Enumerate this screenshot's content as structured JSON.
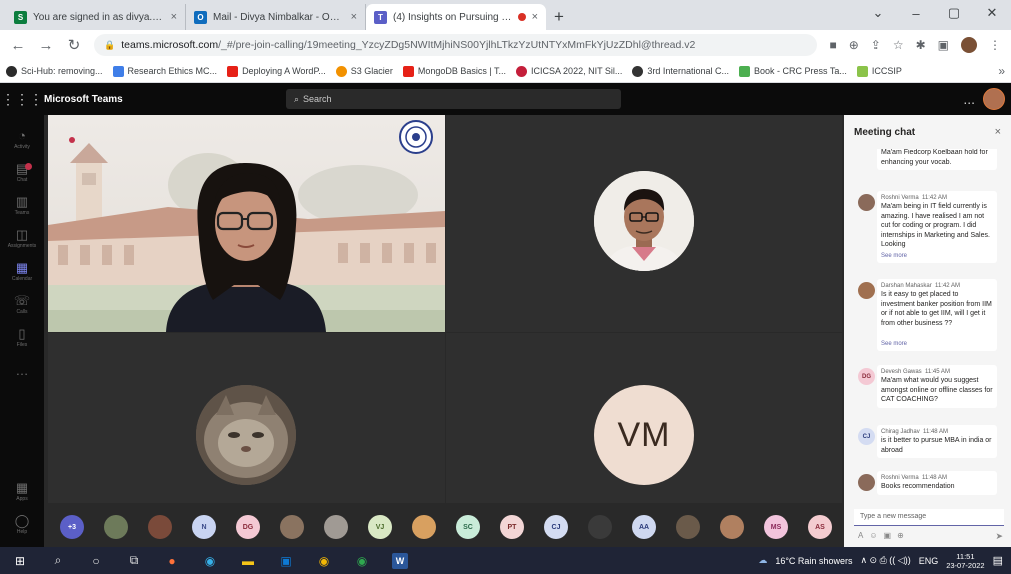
{
  "browser": {
    "tabs": [
      {
        "title": "You are signed in as divya.nimbk",
        "favicon_color": "#0c7d3e",
        "favicon_glyph": "S"
      },
      {
        "title": "Mail - Divya Nimbalkar - Outlook",
        "favicon_color": "#0f6cbd",
        "favicon_glyph": "O"
      },
      {
        "title": "(4) Insights on Pursuing MB",
        "favicon_color": "#5b5fc7",
        "favicon_glyph": "T"
      }
    ],
    "new_tab": "+",
    "url_host": "teams.microsoft.com",
    "url_path": "/_#/pre-join-calling/19meeting_YzcyZDg5NWItMjhiNS00YjlhLTkzYzUtNTYxMmFkYjUzZDhl@thread.v2",
    "bookmarks": [
      {
        "label": "Sci-Hub: removing...",
        "color": "#2b2b2b"
      },
      {
        "label": "Research Ethics MC...",
        "color": "#3f7ee8"
      },
      {
        "label": "Deploying A WordP...",
        "color": "#e62117"
      },
      {
        "label": "S3 Glacier",
        "color": "#f29100"
      },
      {
        "label": "MongoDB Basics | T...",
        "color": "#e62117"
      },
      {
        "label": "ICICSA 2022, NIT Sil...",
        "color": "#c41e3a"
      },
      {
        "label": "3rd International C...",
        "color": "#333333"
      },
      {
        "label": "Book - CRC Press Ta...",
        "color": "#4caf50"
      },
      {
        "label": "ICCSIP",
        "color": "#8bc34a"
      }
    ],
    "bookmarks_more": "»"
  },
  "teams": {
    "app_name": "Microsoft Teams",
    "search_placeholder": "Search",
    "more": "...",
    "rail": [
      {
        "label": "Activity",
        "icon": "bell-icon",
        "glyph": "🔔",
        "active": false,
        "badge": false
      },
      {
        "label": "Chat",
        "icon": "chat-icon",
        "glyph": "💬",
        "active": false,
        "badge": true
      },
      {
        "label": "Teams",
        "icon": "teams-icon",
        "glyph": "👥",
        "active": false,
        "badge": false
      },
      {
        "label": "Assignments",
        "icon": "assignments-icon",
        "glyph": "📋",
        "active": false,
        "badge": false
      },
      {
        "label": "Calendar",
        "icon": "calendar-icon",
        "glyph": "▦",
        "active": true,
        "badge": false
      },
      {
        "label": "Calls",
        "icon": "phone-icon",
        "glyph": "📞",
        "active": false,
        "badge": false
      },
      {
        "label": "Files",
        "icon": "files-icon",
        "glyph": "📄",
        "active": false,
        "badge": false
      },
      {
        "label": "",
        "icon": "more-icon",
        "glyph": "…",
        "active": false,
        "badge": false
      }
    ],
    "rail_bottom": [
      {
        "label": "Apps",
        "icon": "apps-icon",
        "glyph": "▦"
      },
      {
        "label": "Help",
        "icon": "help-icon",
        "glyph": "?"
      }
    ],
    "vm_initials": "VM",
    "attendees": [
      {
        "initials": "+3",
        "color": "#5b5fc7",
        "photo": false
      },
      {
        "initials": "",
        "color": "#6d7a5a",
        "photo": true
      },
      {
        "initials": "",
        "color": "#7a4a3a",
        "photo": true
      },
      {
        "initials": "N",
        "color": "#c9d4f2",
        "photo": false,
        "text_color": "#3b4a8a"
      },
      {
        "initials": "DG",
        "color": "#f4c9d4",
        "photo": false,
        "text_color": "#8a2a3a"
      },
      {
        "initials": "",
        "color": "#8a7360",
        "photo": true
      },
      {
        "initials": "",
        "color": "#a09a94",
        "photo": true
      },
      {
        "initials": "VJ",
        "color": "#d9e8c4",
        "photo": false,
        "text_color": "#4a6a2a"
      },
      {
        "initials": "",
        "color": "#d8a060",
        "photo": true
      },
      {
        "initials": "SC",
        "color": "#c9ecd9",
        "photo": false,
        "text_color": "#2a6a4a"
      },
      {
        "initials": "PT",
        "color": "#f3d6d6",
        "photo": false,
        "text_color": "#7a2a2a"
      },
      {
        "initials": "CJ",
        "color": "#d4dcf2",
        "photo": false,
        "text_color": "#2a3a7a"
      },
      {
        "initials": "",
        "color": "#3a3a3a",
        "photo": true
      },
      {
        "initials": "AA",
        "color": "#cfd8f0",
        "photo": false,
        "text_color": "#2a3a7a"
      },
      {
        "initials": "",
        "color": "#6a5a4a",
        "photo": true
      },
      {
        "initials": "",
        "color": "#b08060",
        "photo": true
      },
      {
        "initials": "MS",
        "color": "#f2c4dc",
        "photo": false,
        "text_color": "#8a2a5a"
      },
      {
        "initials": "AS",
        "color": "#f4ccd0",
        "photo": false,
        "text_color": "#8a2a3a"
      }
    ]
  },
  "chat": {
    "title": "Meeting chat",
    "close": "×",
    "messages": [
      {
        "name": "",
        "time": "",
        "text": "Ma'am Fiedcorp Koelbaan hold for enhancing your vocab.",
        "see_more": "",
        "initials": "",
        "avatar_color": "#ffffff",
        "avatar_text": "#000000",
        "photo": false
      },
      {
        "name": "Roshni Verma",
        "time": "11:42 AM",
        "text": "Ma'am being in IT field currently is amazing. I have realised I am not cut for coding or program. I did internships in Marketing and Sales. Looking",
        "see_more": "See more",
        "initials": "",
        "avatar_color": "#8a6a5a",
        "avatar_text": "#ffffff",
        "photo": true
      },
      {
        "name": "Darshan Mahaskar",
        "time": "11:42 AM",
        "text": "Is it easy to get placed to investment banker position from IIM or if not able to get IIM, will I get it from other business ??",
        "see_more": "See more",
        "initials": "",
        "avatar_color": "#a07050",
        "avatar_text": "#ffffff",
        "photo": true
      },
      {
        "name": "Devesh Gawas",
        "time": "11:45 AM",
        "text": "Ma'am what would you suggest amongst online or offline classes for CAT COACHING?",
        "see_more": "",
        "initials": "DG",
        "avatar_color": "#f4c9d4",
        "avatar_text": "#8a2a3a",
        "photo": false
      },
      {
        "name": "Chirag Jadhav",
        "time": "11:48 AM",
        "text": "is it better to pursue MBA in india or abroad",
        "see_more": "",
        "initials": "CJ",
        "avatar_color": "#d4dcf2",
        "avatar_text": "#2a3a7a",
        "photo": false
      },
      {
        "name": "Roshni Verma",
        "time": "11:48 AM",
        "text": "Books recommendation",
        "see_more": "",
        "initials": "",
        "avatar_color": "#8a6a5a",
        "avatar_text": "#ffffff",
        "photo": true
      }
    ],
    "compose_placeholder": "Type a new message",
    "tools": [
      "A",
      "☺",
      "▣",
      "⊕"
    ],
    "send": "➤"
  },
  "taskbar": {
    "apps": [
      {
        "name": "windows-start-icon",
        "glyph": "⊞",
        "color": "#ffffff"
      },
      {
        "name": "search-icon",
        "glyph": "⌕",
        "color": "#ffffff"
      },
      {
        "name": "cortana-icon",
        "glyph": "○",
        "color": "#ffffff"
      },
      {
        "name": "task-view-icon",
        "glyph": "⧉",
        "color": "#ffffff"
      },
      {
        "name": "firefox-icon",
        "glyph": "●",
        "color": "#ff7139"
      },
      {
        "name": "edge-icon",
        "glyph": "e",
        "color": "#36b0e8"
      },
      {
        "name": "files-icon",
        "glyph": "▬",
        "color": "#f5c518"
      },
      {
        "name": "store-icon",
        "glyph": "▣",
        "color": "#0e7ad4"
      },
      {
        "name": "chrome-icon",
        "glyph": "◉",
        "color": "#f2b705"
      },
      {
        "name": "chrome-active-icon",
        "glyph": "◉",
        "color": "#2fa84f"
      },
      {
        "name": "word-icon",
        "glyph": "W",
        "color": "#2b579a"
      }
    ],
    "weather": "16°C  Rain showers",
    "tray_glyphs": "∧  ⊙  ⎙  ((  ◁))",
    "lang": "ENG",
    "time": "11:51",
    "date": "23-07-2022"
  }
}
